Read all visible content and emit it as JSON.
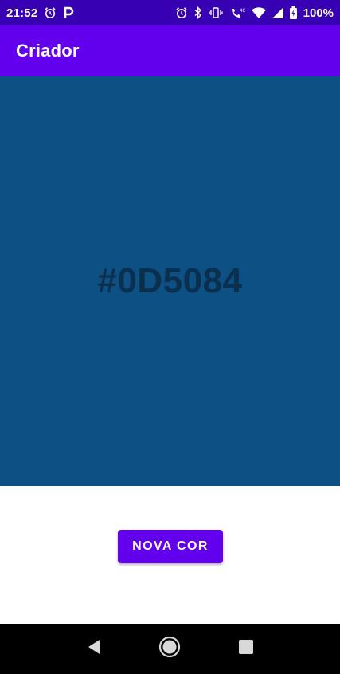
{
  "status_bar": {
    "time": "21:52",
    "battery": "100%",
    "icons_left": [
      "alarm-icon",
      "parking-icon"
    ],
    "icons_right": [
      "alarm-icon",
      "bluetooth-icon",
      "vibrate-icon",
      "wifi-calling-icon",
      "wifi-icon",
      "signal-icon",
      "battery-icon"
    ]
  },
  "app_bar": {
    "title": "Criador",
    "color": "#6200ee"
  },
  "color_panel": {
    "hex": "#0D5084",
    "background": "#0d5084"
  },
  "actions": {
    "new_color_label": "NOVA COR",
    "button_color": "#6200ee"
  },
  "nav_bar": {
    "buttons": [
      "back-icon",
      "home-icon",
      "recents-icon"
    ]
  }
}
